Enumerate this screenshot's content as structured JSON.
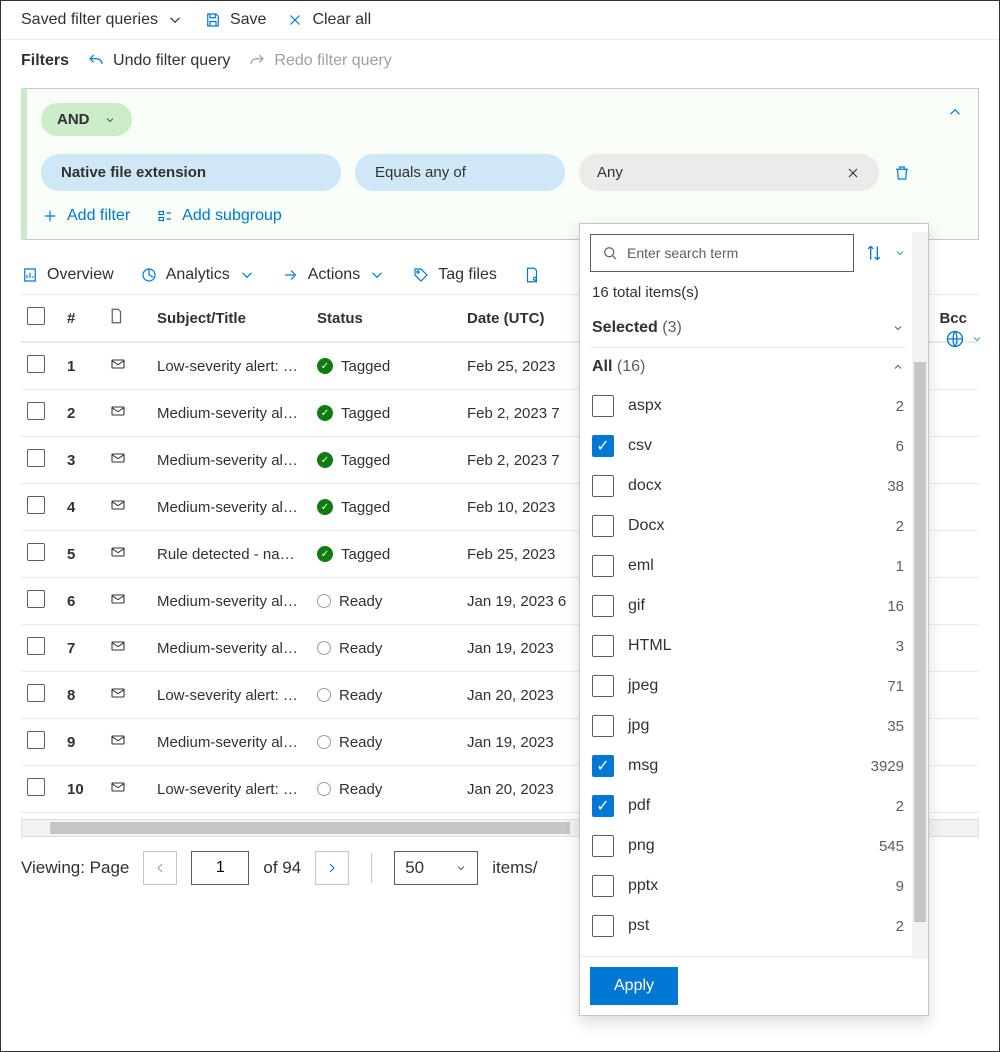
{
  "topbar": {
    "saved_queries": "Saved filter queries",
    "save": "Save",
    "clear_all": "Clear all"
  },
  "filterbar": {
    "label": "Filters",
    "undo": "Undo filter query",
    "redo": "Redo filter query"
  },
  "builder": {
    "operator": "AND",
    "field": "Native file extension",
    "condition": "Equals any of",
    "value": "Any",
    "add_filter": "Add filter",
    "add_subgroup": "Add subgroup"
  },
  "tabs": {
    "overview": "Overview",
    "analytics": "Analytics",
    "actions": "Actions",
    "tag_files": "Tag files"
  },
  "columns": {
    "num": "#",
    "subject": "Subject/Title",
    "status": "Status",
    "date": "Date (UTC)",
    "bcc": "Bcc"
  },
  "rows": [
    {
      "n": "1",
      "subject": "Low-severity alert: …",
      "status": "Tagged",
      "tagged": true,
      "date": "Feb 25, 2023"
    },
    {
      "n": "2",
      "subject": "Medium-severity al…",
      "status": "Tagged",
      "tagged": true,
      "date": "Feb 2, 2023 7"
    },
    {
      "n": "3",
      "subject": "Medium-severity al…",
      "status": "Tagged",
      "tagged": true,
      "date": "Feb 2, 2023 7"
    },
    {
      "n": "4",
      "subject": "Medium-severity al…",
      "status": "Tagged",
      "tagged": true,
      "date": "Feb 10, 2023"
    },
    {
      "n": "5",
      "subject": "Rule detected - na…",
      "status": "Tagged",
      "tagged": true,
      "date": "Feb 25, 2023"
    },
    {
      "n": "6",
      "subject": "Medium-severity al…",
      "status": "Ready",
      "tagged": false,
      "date": "Jan 19, 2023 6"
    },
    {
      "n": "7",
      "subject": "Medium-severity al…",
      "status": "Ready",
      "tagged": false,
      "date": "Jan 19, 2023"
    },
    {
      "n": "8",
      "subject": "Low-severity alert: …",
      "status": "Ready",
      "tagged": false,
      "date": "Jan 20, 2023"
    },
    {
      "n": "9",
      "subject": "Medium-severity al…",
      "status": "Ready",
      "tagged": false,
      "date": "Jan 19, 2023"
    },
    {
      "n": "10",
      "subject": "Low-severity alert: …",
      "status": "Ready",
      "tagged": false,
      "date": "Jan 20, 2023"
    }
  ],
  "pager": {
    "viewing": "Viewing: Page",
    "page": "1",
    "of_total": "of 94",
    "page_size": "50",
    "items_label": "items/"
  },
  "dropdown": {
    "search_placeholder": "Enter search term",
    "total_label": "16 total items(s)",
    "selected_label": "Selected",
    "selected_count": "(3)",
    "all_label": "All",
    "all_count": "(16)",
    "apply": "Apply",
    "options": [
      {
        "label": "aspx",
        "count": "2",
        "checked": false
      },
      {
        "label": "csv",
        "count": "6",
        "checked": true
      },
      {
        "label": "docx",
        "count": "38",
        "checked": false
      },
      {
        "label": "Docx",
        "count": "2",
        "checked": false
      },
      {
        "label": "eml",
        "count": "1",
        "checked": false
      },
      {
        "label": "gif",
        "count": "16",
        "checked": false
      },
      {
        "label": "HTML",
        "count": "3",
        "checked": false
      },
      {
        "label": "jpeg",
        "count": "71",
        "checked": false
      },
      {
        "label": "jpg",
        "count": "35",
        "checked": false
      },
      {
        "label": "msg",
        "count": "3929",
        "checked": true
      },
      {
        "label": "pdf",
        "count": "2",
        "checked": true
      },
      {
        "label": "png",
        "count": "545",
        "checked": false
      },
      {
        "label": "pptx",
        "count": "9",
        "checked": false
      },
      {
        "label": "pst",
        "count": "2",
        "checked": false
      }
    ]
  }
}
